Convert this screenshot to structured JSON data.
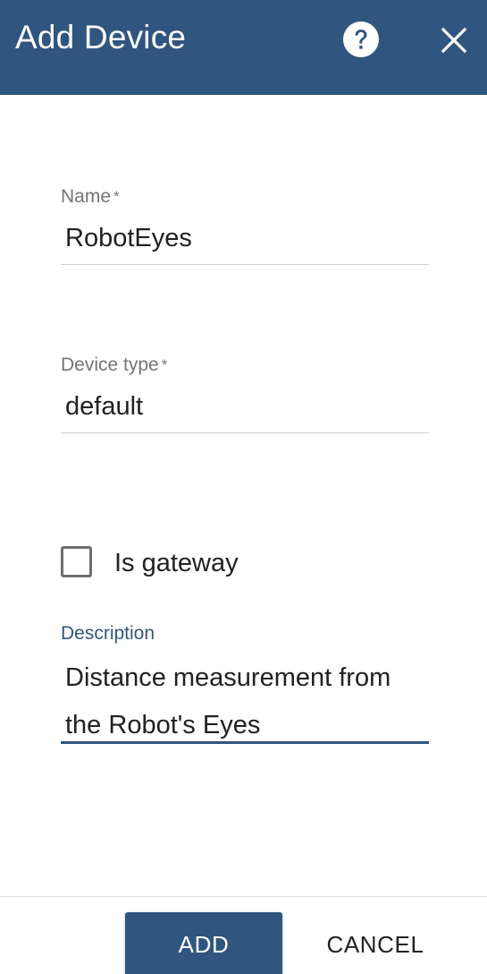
{
  "header": {
    "title": "Add Device",
    "help_icon": "help-circle-icon",
    "close_icon": "close-icon"
  },
  "form": {
    "name": {
      "label": "Name",
      "required_mark": "*",
      "value": "RobotEyes"
    },
    "device_type": {
      "label": "Device type",
      "required_mark": "*",
      "value": "default"
    },
    "is_gateway": {
      "label": "Is gateway",
      "checked": false
    },
    "description": {
      "label": "Description",
      "value": "Distance measurement from the Robot's Eyes"
    }
  },
  "footer": {
    "add_label": "ADD",
    "cancel_label": "CANCEL"
  },
  "colors": {
    "primary": "#305680",
    "text": "#212121",
    "label": "#757575"
  }
}
